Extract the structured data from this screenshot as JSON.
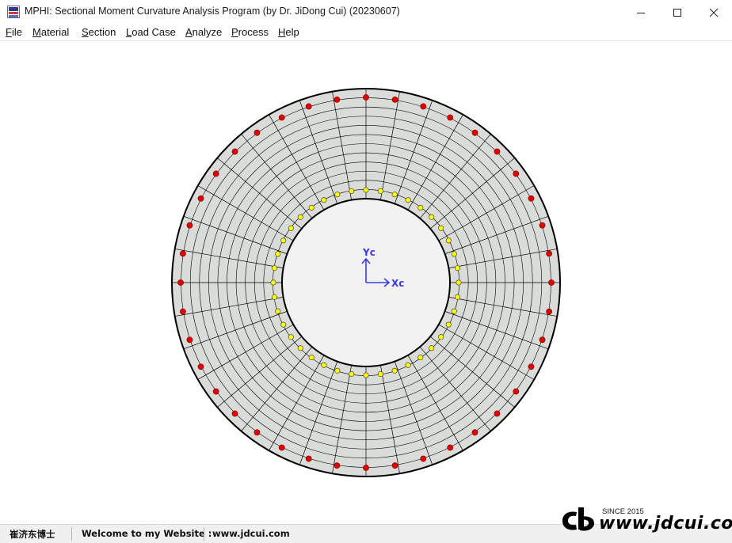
{
  "window": {
    "title": "MPHI: Sectional Moment Curvature Analysis Program (by Dr. JiDong Cui) (20230607)",
    "icon": "mphi-app-icon",
    "controls": [
      "minimize-icon",
      "maximize-icon",
      "close-icon"
    ]
  },
  "menu": {
    "items": [
      {
        "label": "File",
        "mnemonic": "F",
        "rest": "ile"
      },
      {
        "label": "Material",
        "mnemonic": "M",
        "rest": "aterial"
      },
      {
        "label": "Section",
        "mnemonic": "S",
        "rest": "ection"
      },
      {
        "label": "Load Case",
        "mnemonic": "L",
        "rest": "oad Case"
      },
      {
        "label": "Analyze",
        "mnemonic": "A",
        "rest": "nalyze"
      },
      {
        "label": "Process",
        "mnemonic": "P",
        "rest": "rocess"
      },
      {
        "label": "Help",
        "mnemonic": "H",
        "rest": "elp"
      }
    ]
  },
  "section": {
    "shape": "hollow circular section",
    "radial_divisions": 12,
    "circumferential_divisions": 36,
    "outer_bar_count": 40,
    "inner_bar_count": 40,
    "colors": {
      "fill": "#dadcda",
      "hole": "#f2f2f2",
      "mesh_line": "#000000",
      "outer_bar": "#e00000",
      "inner_bar": "#ffff00",
      "axis": "#3a3ae0"
    },
    "axes": {
      "x_label": "Xc",
      "y_label": "Yc"
    }
  },
  "status": {
    "author": "崔济东博士",
    "welcome": "Welcome to my Website :",
    "website": "www.jdcui.com"
  },
  "logo": {
    "since": "SINCE 2015",
    "url": "www.jdcui.com",
    "mark": "cd-logo-mark"
  }
}
